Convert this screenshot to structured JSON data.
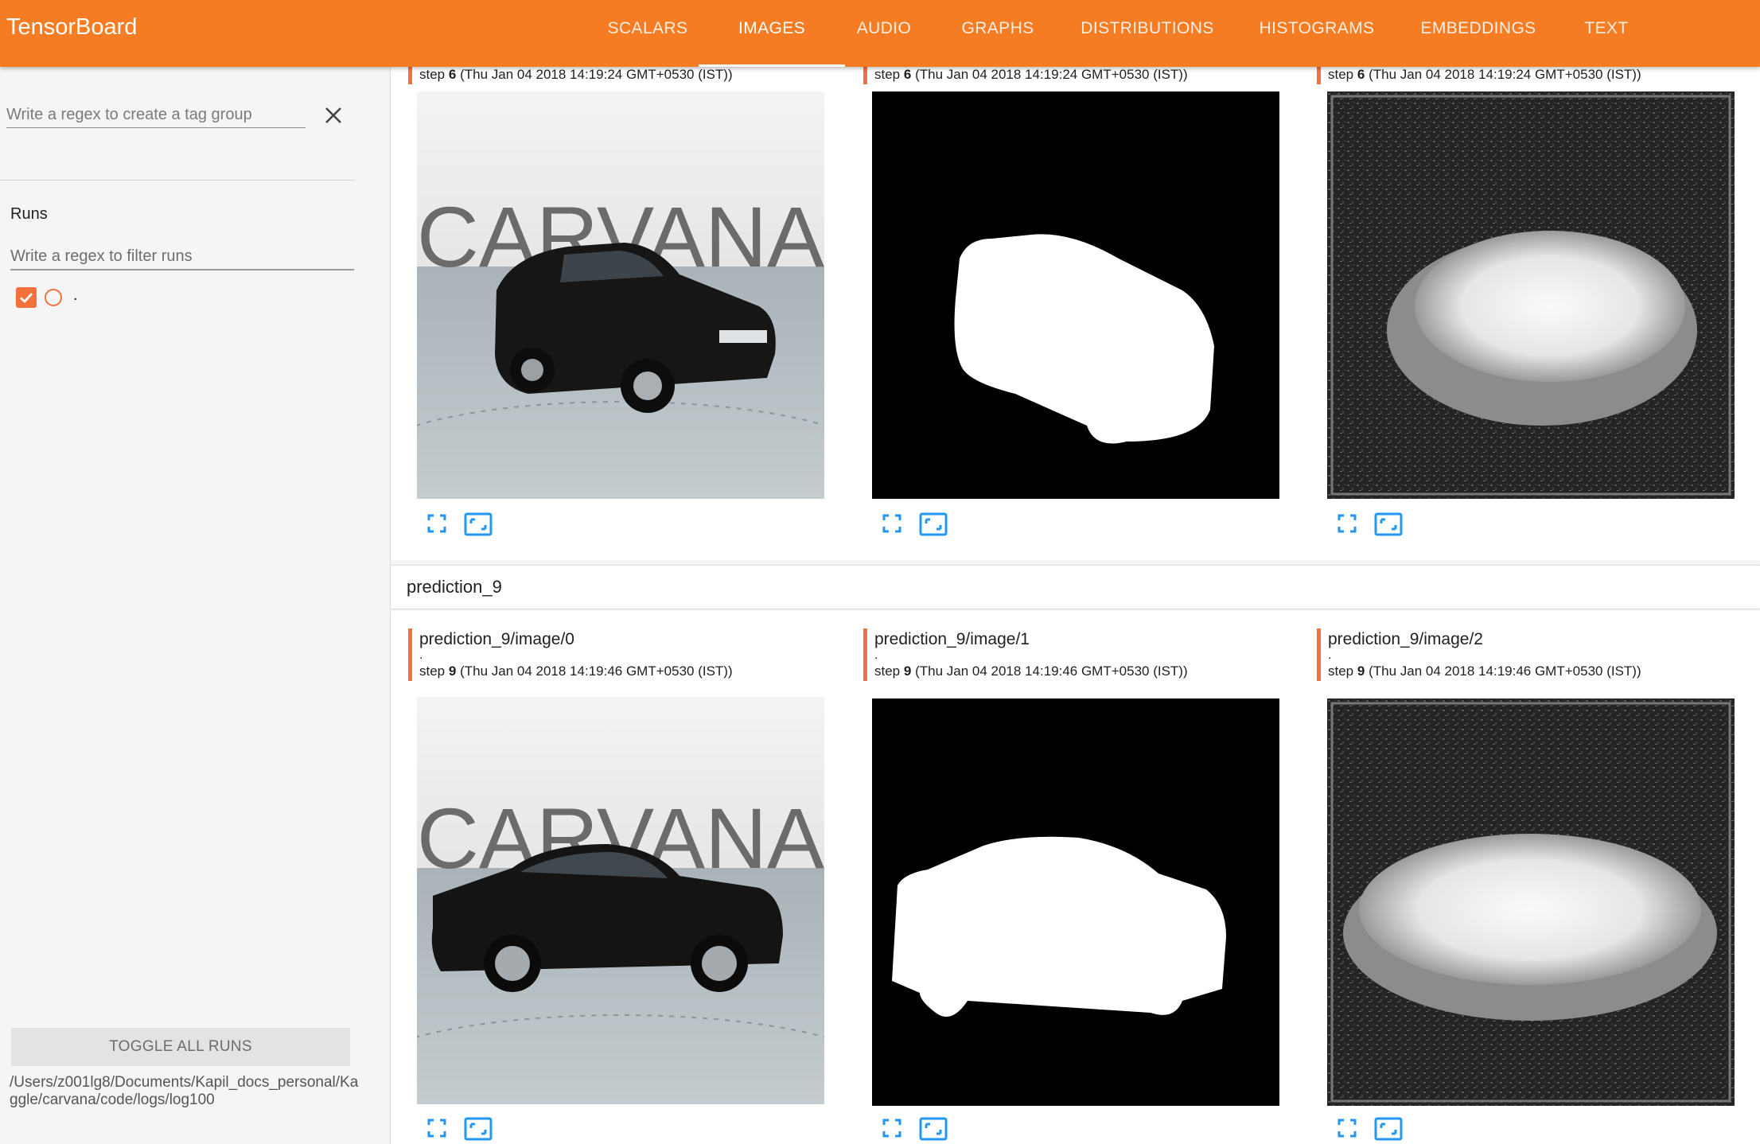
{
  "app": {
    "title": "TensorBoard"
  },
  "nav": {
    "tabs": [
      {
        "label": "SCALARS",
        "active": false
      },
      {
        "label": "IMAGES",
        "active": true
      },
      {
        "label": "AUDIO",
        "active": false
      },
      {
        "label": "GRAPHS",
        "active": false
      },
      {
        "label": "DISTRIBUTIONS",
        "active": false
      },
      {
        "label": "HISTOGRAMS",
        "active": false
      },
      {
        "label": "EMBEDDINGS",
        "active": false
      },
      {
        "label": "TEXT",
        "active": false
      }
    ]
  },
  "sidebar": {
    "tag_group_placeholder": "Write a regex to create a tag group",
    "runs_label": "Runs",
    "runs_filter_placeholder": "Write a regex to filter runs",
    "runs": [
      {
        "name": ".",
        "checked": true,
        "color": "#f4713c"
      }
    ],
    "toggle_all_label": "TOGGLE ALL RUNS",
    "logdir": "/Users/z001lg8/Documents/Kapil_docs_personal/Kaggle/carvana/code/logs/log100"
  },
  "sections": [
    {
      "title": "",
      "cards": [
        {
          "title": "",
          "step_label": "step",
          "step": "6",
          "timestamp": "(Thu Jan 04 2018 14:19:24 GMT+0530 (IST))",
          "image": "car-photo"
        },
        {
          "title": "",
          "step_label": "step",
          "step": "6",
          "timestamp": "(Thu Jan 04 2018 14:19:24 GMT+0530 (IST))",
          "image": "mask"
        },
        {
          "title": "",
          "step_label": "step",
          "step": "6",
          "timestamp": "(Thu Jan 04 2018 14:19:24 GMT+0530 (IST))",
          "image": "prediction"
        }
      ]
    },
    {
      "title": "prediction_9",
      "cards": [
        {
          "title": "prediction_9/image/0",
          "dot": ".",
          "step_label": "step",
          "step": "9",
          "timestamp": "(Thu Jan 04 2018 14:19:46 GMT+0530 (IST))",
          "image": "car-photo"
        },
        {
          "title": "prediction_9/image/1",
          "dot": ".",
          "step_label": "step",
          "step": "9",
          "timestamp": "(Thu Jan 04 2018 14:19:46 GMT+0530 (IST))",
          "image": "mask"
        },
        {
          "title": "prediction_9/image/2",
          "dot": ".",
          "step_label": "step",
          "step": "9",
          "timestamp": "(Thu Jan 04 2018 14:19:46 GMT+0530 (IST))",
          "image": "prediction"
        }
      ]
    }
  ],
  "images": {
    "watermark_text": "CARVANA"
  },
  "colors": {
    "accent": "#f57c22",
    "run": "#f4713c",
    "icon": "#2196f3"
  },
  "icons": {
    "expand": "fullscreen-icon",
    "actual_size": "actual-size-icon",
    "clear": "close-icon",
    "check": "check-icon"
  }
}
